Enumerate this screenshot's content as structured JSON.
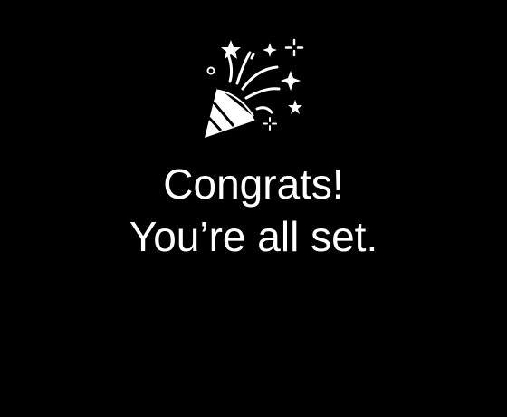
{
  "screen": {
    "background_color": "#000000",
    "text_color": "#ffffff",
    "icon": "party-popper-icon",
    "headline": "Congrats!",
    "subline": "You’re all set."
  }
}
